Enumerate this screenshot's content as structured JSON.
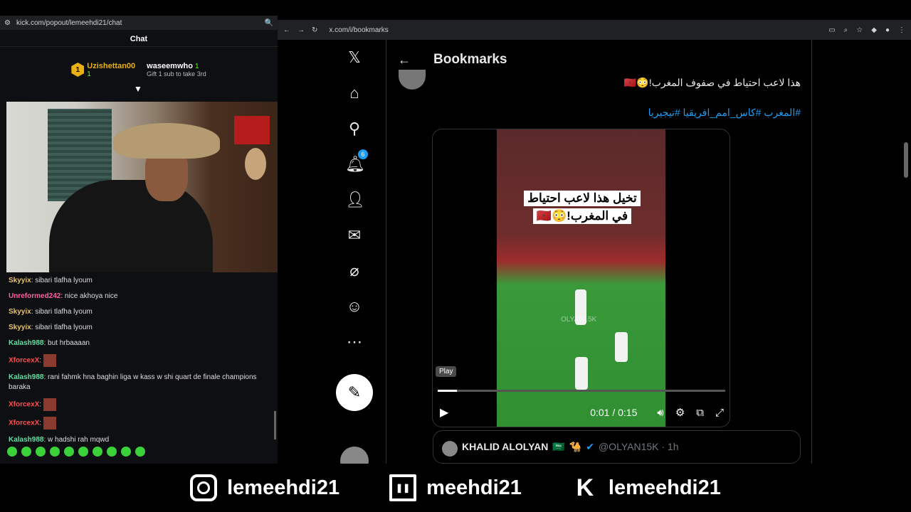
{
  "left_window": {
    "url": "kick.com/popout/lemeehdi21/chat",
    "chat_title": "Chat",
    "top_gifters": [
      {
        "rank": "1",
        "name": "Uzishettan00",
        "count": "1"
      },
      {
        "name": "waseemwho",
        "count": "1",
        "hint": "Gift 1 sub to take 3rd"
      }
    ],
    "messages": [
      {
        "user": "Skyyix",
        "text": "sibari tlafha lyoum",
        "color": "u-yellow"
      },
      {
        "user": "Unreformed242",
        "text": "nice akhoya nice",
        "color": "u-pink"
      },
      {
        "user": "Skyyix",
        "text": "sibari tlafha lyoum",
        "color": "u-yellow"
      },
      {
        "user": "Skyyix",
        "text": "sibari tlafha lyoum",
        "color": "u-yellow"
      },
      {
        "user": "Kalash988",
        "text": "but hrbaaaan",
        "color": "u-green"
      },
      {
        "user": "XforcexX",
        "text": "",
        "color": "u-red"
      },
      {
        "user": "Kalash988",
        "text": "rani fahmk hna baghin liga w kass w shi quart de finale champions baraka",
        "color": "u-green"
      },
      {
        "user": "XforcexX",
        "text": "",
        "color": "u-red"
      },
      {
        "user": "XforcexX",
        "text": "",
        "color": "u-red"
      },
      {
        "user": "Kalash988",
        "text": "w hadshi rah mqwd",
        "color": "u-green"
      }
    ]
  },
  "browser": {
    "url": "x.com/i/bookmarks"
  },
  "x_app": {
    "notif_count": "6",
    "header_title": "Bookmarks",
    "tweet_text": "هذا لاعب احتياط في صفوف المغرب!😳🇲🇦",
    "tweet_tags": "#المغرب #كاس_امم_افريقيا #نيجيريا",
    "video_overlay_line1": "تخيل هذا لاعب احتياط",
    "video_overlay_line2": "في المغرب!😳🇲🇦",
    "watermark": "OLYAN15K",
    "tooltip": "Play",
    "time": "0:01 / 0:15",
    "progress_fraction": 0.067,
    "quote_name": "KHALID ALOLYAN",
    "quote_handle": "@OLYAN15K · 1h"
  },
  "footer": {
    "instagram": "lemeehdi21",
    "twitch": "meehdi21",
    "kick": "lemeehdi21"
  },
  "colors": {
    "kick_green": "#53fc18",
    "x_blue": "#1d9bf0"
  }
}
